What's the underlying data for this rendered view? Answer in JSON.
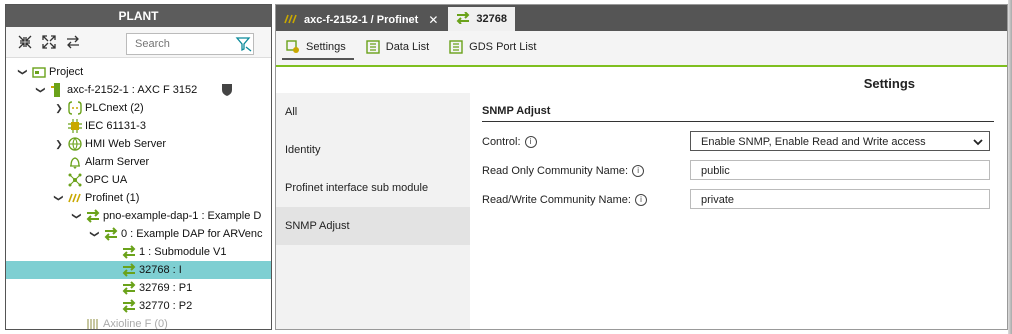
{
  "plant": {
    "title": "PLANT",
    "search_placeholder": "Search",
    "toolbar_icons": [
      "collapse-all-icon",
      "expand-all-icon",
      "swap-arrows-icon"
    ],
    "tree": [
      {
        "label": "Project",
        "level": 0,
        "toggle": "open",
        "icon": "project-icon"
      },
      {
        "label": "axc-f-2152-1 : AXC F 3152",
        "level": 1,
        "toggle": "open",
        "icon": "controller-icon"
      },
      {
        "label": "PLCnext (2)",
        "level": 2,
        "toggle": "closed",
        "icon": "plcnext-icon"
      },
      {
        "label": "IEC 61131-3",
        "level": 2,
        "toggle": "",
        "icon": "chip-icon"
      },
      {
        "label": "HMI Web Server",
        "level": 2,
        "toggle": "closed",
        "icon": "globe-icon"
      },
      {
        "label": "Alarm Server",
        "level": 2,
        "toggle": "",
        "icon": "bell-icon"
      },
      {
        "label": "OPC UA",
        "level": 2,
        "toggle": "",
        "icon": "network-icon"
      },
      {
        "label": "Profinet (1)",
        "level": 2,
        "toggle": "open",
        "icon": "profinet-icon"
      },
      {
        "label": "pno-example-dap-1 : Example D",
        "level": 3,
        "toggle": "open",
        "icon": "device-arrows-icon"
      },
      {
        "label": "0 : Example DAP for ARVenc",
        "level": 4,
        "toggle": "open",
        "icon": "device-arrows-icon"
      },
      {
        "label": "1 : Submodule V1",
        "level": 5,
        "toggle": "",
        "icon": "device-arrows-icon"
      },
      {
        "label": "32768 : I",
        "level": 5,
        "toggle": "",
        "icon": "device-arrows-icon",
        "selected": true
      },
      {
        "label": "32769 : P1",
        "level": 5,
        "toggle": "",
        "icon": "device-arrows-icon"
      },
      {
        "label": "32770 : P2",
        "level": 5,
        "toggle": "",
        "icon": "device-arrows-icon"
      },
      {
        "label": "Axioline F (0)",
        "level": 3,
        "toggle": "",
        "icon": "axioline-icon",
        "faded": true
      }
    ]
  },
  "editor": {
    "doc_tabs": [
      {
        "label": "axc-f-2152-1 / Profinet",
        "active": false,
        "close": "✕"
      },
      {
        "label": "32768",
        "active": true,
        "close": ""
      }
    ],
    "view_tabs": [
      {
        "label": "Settings",
        "active": true
      },
      {
        "label": "Data List",
        "active": false
      },
      {
        "label": "GDS Port List",
        "active": false
      }
    ],
    "settings_title": "Settings",
    "categories": [
      {
        "label": "All",
        "active": false
      },
      {
        "label": "Identity",
        "active": false
      },
      {
        "label": "Profinet interface sub module",
        "active": false
      },
      {
        "label": "SNMP Adjust",
        "active": true
      }
    ],
    "section_title": "SNMP Adjust",
    "fields": {
      "control_label": "Control:",
      "control_value": "Enable SNMP, Enable Read and Write access",
      "ro_label": "Read Only Community Name:",
      "ro_value": "public",
      "rw_label": "Read/Write Community Name:",
      "rw_value": "private"
    }
  },
  "colors": {
    "accent_green": "#7fbf1f",
    "selection": "#7ecfd2",
    "header_dark": "#5c5c5c"
  }
}
